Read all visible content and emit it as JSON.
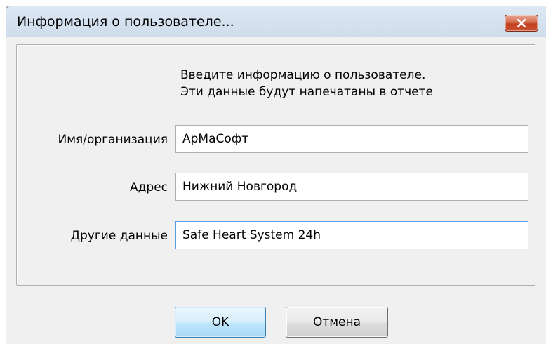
{
  "window": {
    "title": "Информация о пользователе..."
  },
  "intro": {
    "line1": "Введите информацию о пользователе.",
    "line2": "Эти данные будут напечатаны в отчете"
  },
  "fields": {
    "name": {
      "label": "Имя/организация",
      "value": "АрМаСофт"
    },
    "address": {
      "label": "Адрес",
      "value": "Нижний Новгород"
    },
    "other": {
      "label": "Другие данные",
      "value": "Safe Heart System 24h"
    }
  },
  "buttons": {
    "ok": "OK",
    "cancel": "Отмена"
  },
  "icons": {
    "close": "close-icon"
  },
  "colors": {
    "close_button": "#c9502f",
    "focus_border": "#569de5",
    "default_button_border": "#3c7fb1"
  }
}
